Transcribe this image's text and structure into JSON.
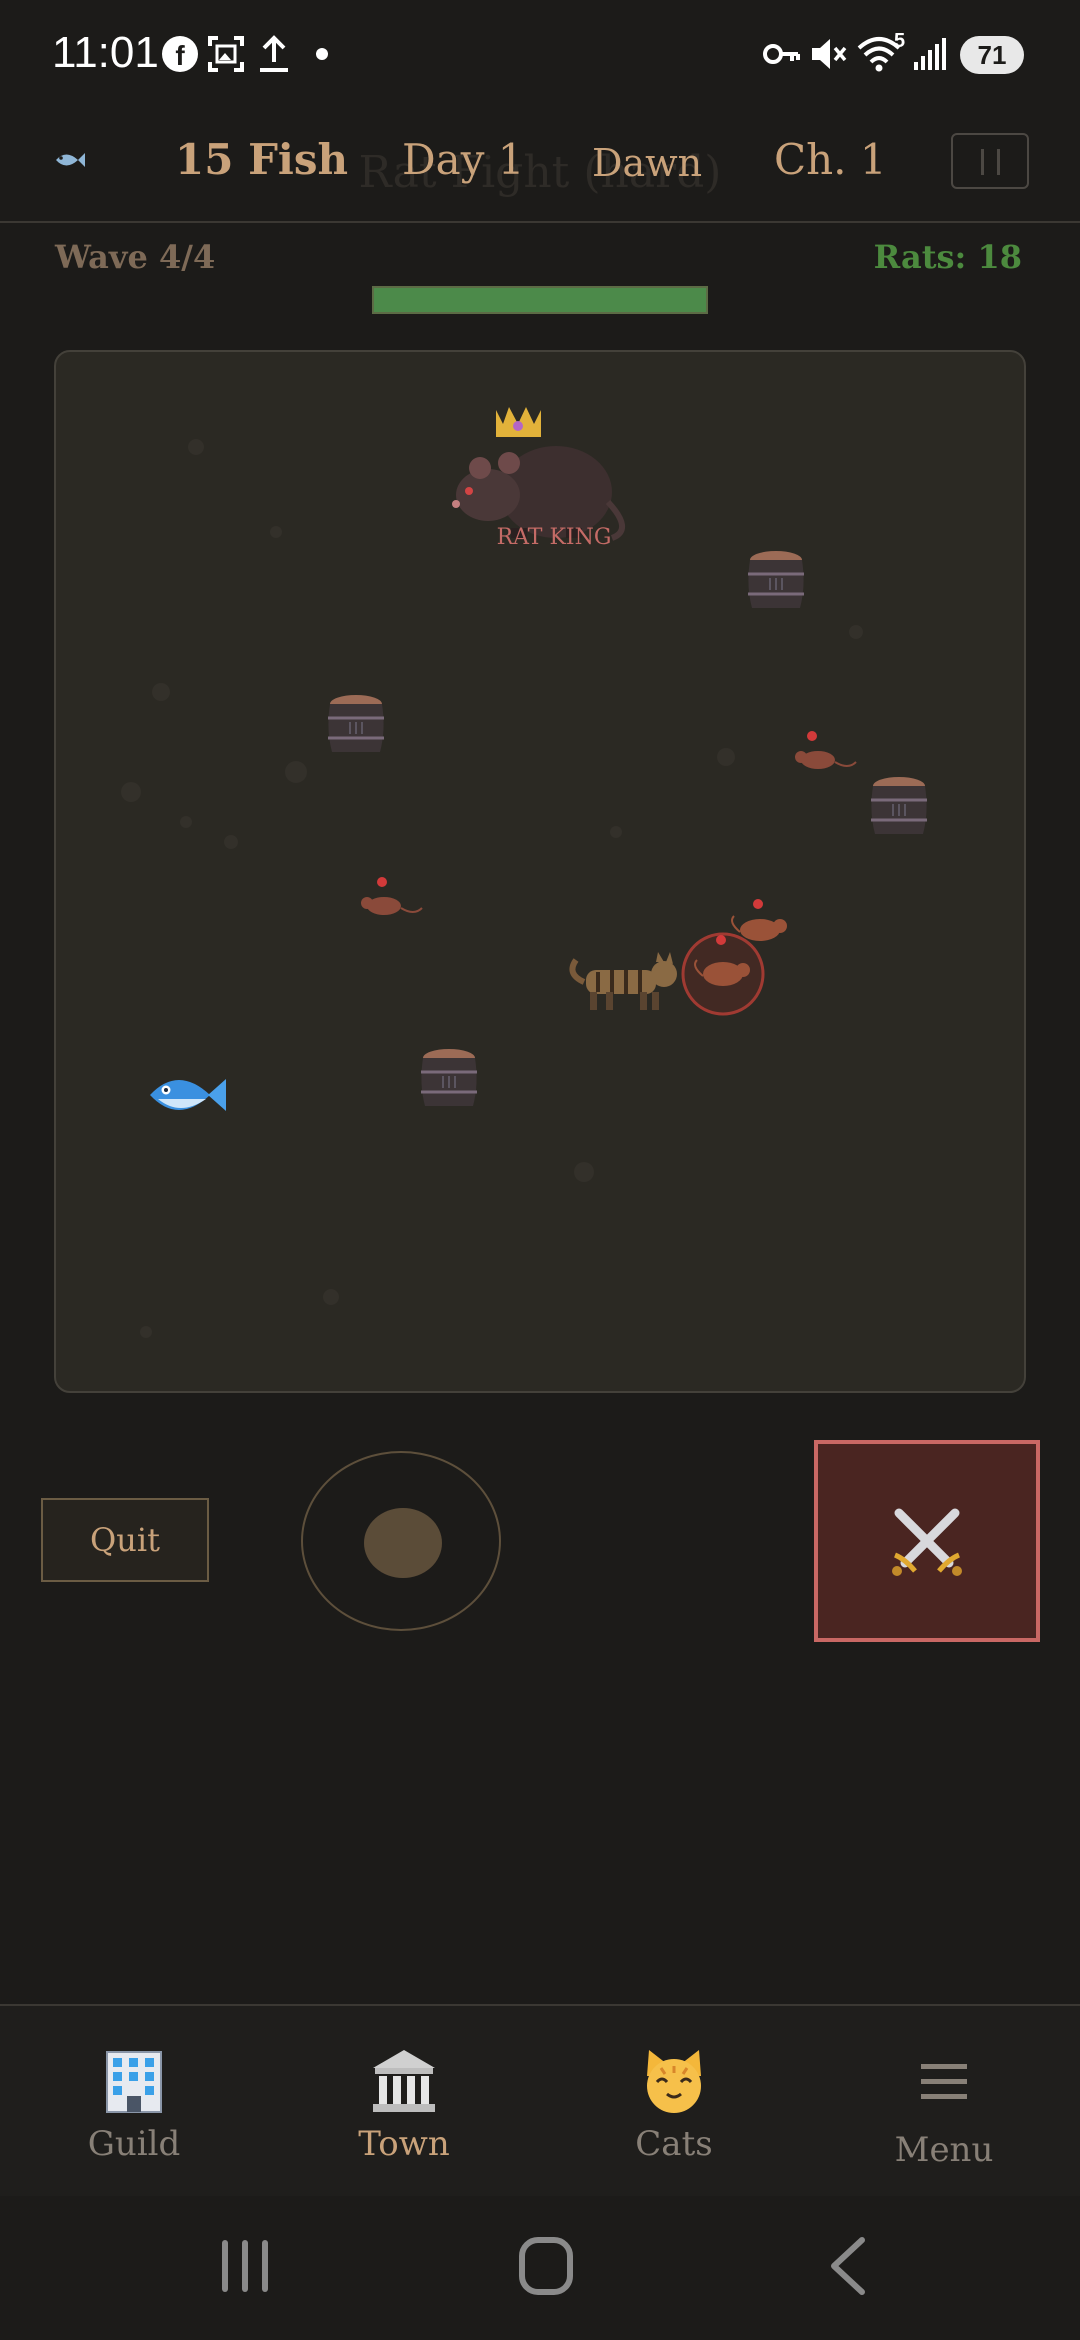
{
  "status_bar": {
    "time": "11:01",
    "battery": "71",
    "network_badge": "5",
    "icons": [
      "facebook-icon",
      "screenshot-icon",
      "upload-icon",
      "vpn-key-icon",
      "mute-icon",
      "wifi-icon",
      "signal-icon",
      "battery-icon"
    ]
  },
  "header": {
    "screen_title": "Rat Fight (hard)",
    "fish_count": "15 Fish",
    "day": "Day 1",
    "time_of_day": "Dawn",
    "chapter": "Ch. 1"
  },
  "battle": {
    "wave": "Wave 4/4",
    "rats_remaining": "Rats: 18",
    "wave_progress": 1.0,
    "boss_name": "RAT KING"
  },
  "controls": {
    "quit_label": "Quit",
    "attack_icon": "crossed-swords-icon"
  },
  "bottom_nav": {
    "items": [
      {
        "label": "Guild",
        "icon": "office-building-icon",
        "active": false
      },
      {
        "label": "Town",
        "icon": "classical-building-icon",
        "active": true
      },
      {
        "label": "Cats",
        "icon": "cat-face-icon",
        "active": false
      },
      {
        "label": "Menu",
        "icon": "hamburger-menu-icon",
        "active": false
      }
    ]
  },
  "colors": {
    "background": "#1c1b19",
    "accent_tan": "#c9a27a",
    "rats_green": "#4c8a3e",
    "attack_red": "#c96864",
    "arena": "#2b2923"
  }
}
